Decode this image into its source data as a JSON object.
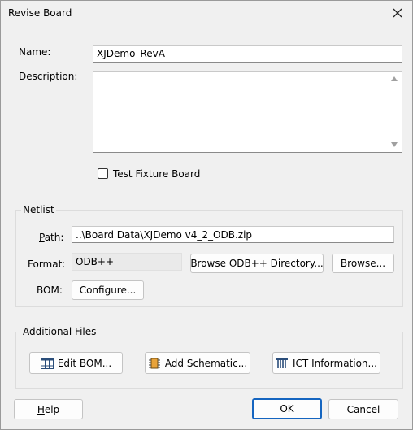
{
  "window": {
    "title": "Revise Board",
    "close_icon": "close-icon"
  },
  "form": {
    "name_label": "Name:",
    "name_value": "XJDemo_RevA",
    "description_label": "Description:",
    "description_value": "",
    "test_fixture_label": "Test Fixture Board",
    "test_fixture_checked": false
  },
  "netlist": {
    "group_title": "Netlist",
    "path_label": "Path:",
    "path_value": "..\\Board Data\\XJDemo v4_2_ODB.zip",
    "format_label": "Format:",
    "format_value": "ODB++",
    "browse_odb_label": "Browse ODB++ Directory...",
    "browse_label": "Browse...",
    "bom_label": "BOM:",
    "configure_label": "Configure..."
  },
  "additional_files": {
    "group_title": "Additional Files",
    "edit_bom_label": "Edit BOM...",
    "add_schematic_label": "Add Schematic...",
    "ict_info_label": "ICT Information..."
  },
  "footer": {
    "help_label": "Help",
    "ok_label": "OK",
    "cancel_label": "Cancel"
  },
  "colors": {
    "accent": "#1565c0",
    "background": "#f0f0f0"
  }
}
